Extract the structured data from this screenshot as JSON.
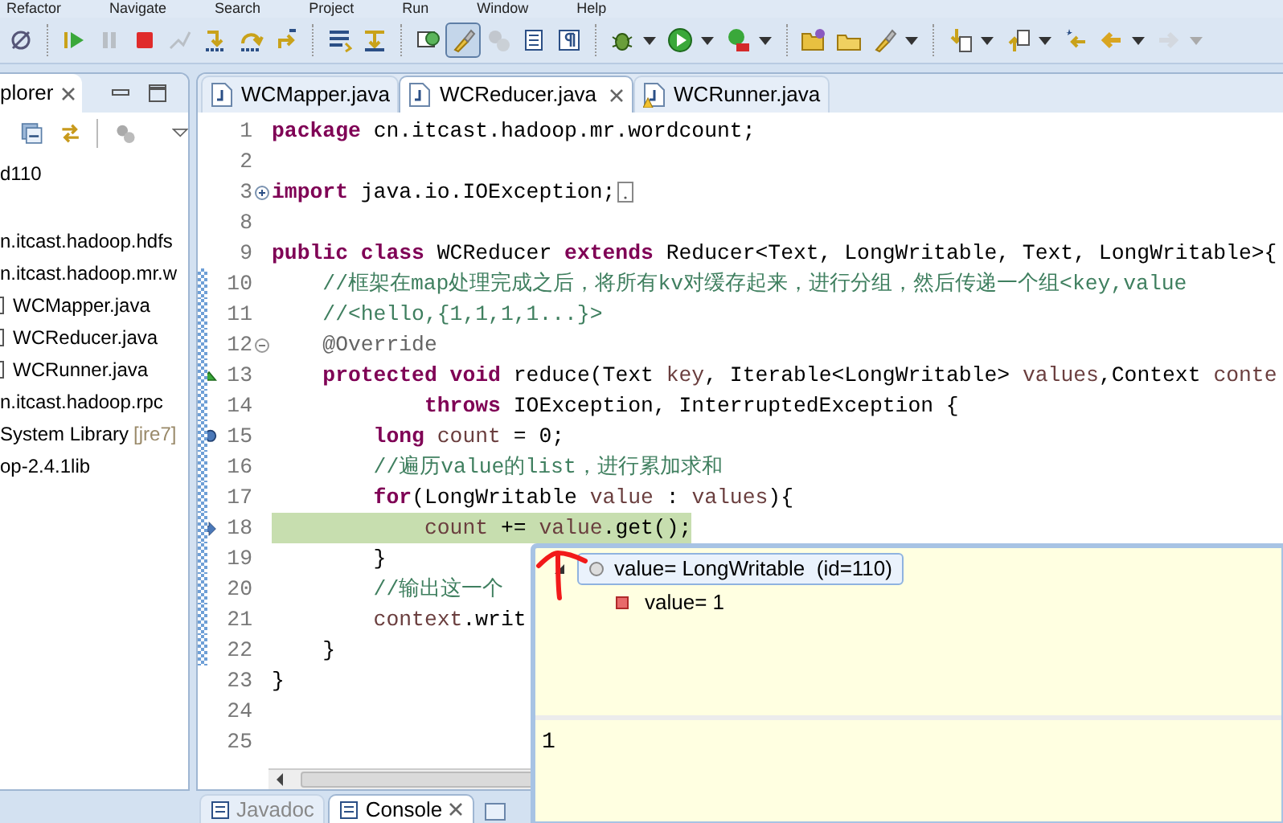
{
  "menu": [
    "Refactor",
    "Navigate",
    "Search",
    "Project",
    "Run",
    "Window",
    "Help"
  ],
  "toolbar": [
    {
      "kind": "link",
      "disabled": false,
      "pressed": false,
      "menu": false
    },
    {
      "kind": "separator"
    },
    {
      "kind": "resume",
      "disabled": false,
      "pressed": false,
      "menu": false
    },
    {
      "kind": "suspend",
      "disabled": true,
      "pressed": false,
      "menu": false
    },
    {
      "kind": "terminate",
      "disabled": false,
      "pressed": false,
      "menu": false
    },
    {
      "kind": "disconnect",
      "disabled": true,
      "pressed": false,
      "menu": false
    },
    {
      "kind": "step-into",
      "disabled": false,
      "pressed": false,
      "menu": false
    },
    {
      "kind": "step-over",
      "disabled": false,
      "pressed": false,
      "menu": false
    },
    {
      "kind": "step-return",
      "disabled": false,
      "pressed": false,
      "menu": false
    },
    {
      "kind": "separator"
    },
    {
      "kind": "lines",
      "disabled": false,
      "pressed": false,
      "menu": false
    },
    {
      "kind": "step-filter",
      "disabled": false,
      "pressed": false,
      "menu": false
    },
    {
      "kind": "separator"
    },
    {
      "kind": "display",
      "disabled": false,
      "pressed": false,
      "menu": false
    },
    {
      "kind": "brush",
      "disabled": false,
      "pressed": true,
      "menu": false
    },
    {
      "kind": "gears",
      "disabled": true,
      "pressed": false,
      "menu": false
    },
    {
      "kind": "document",
      "disabled": false,
      "pressed": false,
      "menu": false
    },
    {
      "kind": "pilcrow",
      "disabled": false,
      "pressed": false,
      "menu": false
    },
    {
      "kind": "separator"
    },
    {
      "kind": "bug",
      "disabled": false,
      "pressed": false,
      "menu": true
    },
    {
      "kind": "run",
      "disabled": false,
      "pressed": false,
      "menu": true
    },
    {
      "kind": "run-toolbox",
      "disabled": false,
      "pressed": false,
      "menu": true
    },
    {
      "kind": "separator"
    },
    {
      "kind": "folder-open",
      "disabled": false,
      "pressed": false,
      "menu": false
    },
    {
      "kind": "folder",
      "disabled": false,
      "pressed": false,
      "menu": false
    },
    {
      "kind": "brush",
      "disabled": false,
      "pressed": false,
      "menu": true
    },
    {
      "kind": "separator"
    },
    {
      "kind": "arrow-down-doc",
      "disabled": false,
      "pressed": false,
      "menu": true
    },
    {
      "kind": "arrow-up-doc",
      "disabled": false,
      "pressed": false,
      "menu": true
    },
    {
      "kind": "star-left",
      "disabled": false,
      "pressed": false,
      "menu": false
    },
    {
      "kind": "arrow-left",
      "disabled": false,
      "pressed": false,
      "menu": true
    },
    {
      "kind": "arrow-right",
      "disabled": true,
      "pressed": false,
      "menu": true
    }
  ],
  "explorer": {
    "tab": "plorer",
    "tree": [
      {
        "label": "d110",
        "children": [
          {
            "label": "n.itcast.hadoop.hdfs"
          },
          {
            "label": "n.itcast.hadoop.mr.w",
            "children": [
              {
                "label": "WCMapper.java"
              },
              {
                "label": "WCReducer.java"
              },
              {
                "label": "WCRunner.java"
              }
            ]
          },
          {
            "label": "n.itcast.hadoop.rpc"
          },
          {
            "label": "System Library",
            "decoration": "[jre7]"
          },
          {
            "label": "op-2.4.1lib"
          }
        ]
      }
    ]
  },
  "editor": {
    "tabs": [
      {
        "label": "WCMapper.java",
        "selected": false,
        "warning": false
      },
      {
        "label": "WCReducer.java",
        "selected": true,
        "warning": false
      },
      {
        "label": "WCRunner.java",
        "selected": false,
        "warning": true
      }
    ],
    "lines": [
      {
        "number": "1",
        "kind": "code",
        "in_range": false,
        "highlighted": false,
        "segments": [
          {
            "kind": "kw",
            "text": "package"
          },
          {
            "kind": "plain",
            "text": " cn.itcast.hadoop.mr.wordcount;"
          }
        ]
      },
      {
        "number": "2",
        "kind": "code",
        "in_range": false,
        "highlighted": false
      },
      {
        "number": "3",
        "kind": "folded",
        "in_range": false,
        "highlighted": false,
        "segments": [
          {
            "kind": "kw",
            "text": "import"
          },
          {
            "kind": "plain",
            "text": " java.io.IOException;"
          }
        ]
      },
      {
        "number": "8",
        "kind": "code",
        "in_range": false,
        "highlighted": false
      },
      {
        "number": "9",
        "kind": "code",
        "in_range": false,
        "highlighted": false,
        "segments": [
          {
            "kind": "kw",
            "text": "public"
          },
          {
            "kind": "kw",
            "text": " class"
          },
          {
            "kind": "plain",
            "text": " WCReducer "
          },
          {
            "kind": "kw",
            "text": "extends"
          },
          {
            "kind": "plain",
            "text": " Reducer<Text, LongWritable, Text, LongWritable>{"
          }
        ]
      },
      {
        "number": "10",
        "kind": "code",
        "in_range": true,
        "highlighted": false,
        "segments": [
          {
            "kind": "comment",
            "text": "    //框架在map处理完成之后，将所有kv对缓存起来，进行分组，然后传递一个组<key,value"
          }
        ]
      },
      {
        "number": "11",
        "kind": "code",
        "in_range": true,
        "highlighted": false,
        "segments": [
          {
            "kind": "comment",
            "text": "    //<hello,{1,1,1,1...}>"
          }
        ]
      },
      {
        "number": "12",
        "kind": "foldable",
        "in_range": true,
        "highlighted": false,
        "segments": [
          {
            "kind": "annotation",
            "text": "    @Override"
          }
        ]
      },
      {
        "number": "13",
        "kind": "override",
        "in_range": true,
        "highlighted": false,
        "segments": [
          {
            "kind": "kw",
            "text": "    protected"
          },
          {
            "kind": "kw",
            "text": " void"
          },
          {
            "kind": "plain",
            "text": " reduce(Text "
          },
          {
            "kind": "var",
            "text": "key"
          },
          {
            "kind": "plain",
            "text": ", Iterable<LongWritable> "
          },
          {
            "kind": "var",
            "text": "values"
          },
          {
            "kind": "plain",
            "text": ",Context "
          },
          {
            "kind": "var",
            "text": "conte"
          }
        ]
      },
      {
        "number": "14",
        "kind": "code",
        "in_range": true,
        "highlighted": false,
        "segments": [
          {
            "kind": "kw",
            "text": "            throws"
          },
          {
            "kind": "plain",
            "text": " IOException, InterruptedException {"
          }
        ]
      },
      {
        "number": "15",
        "kind": "breakpoint",
        "in_range": true,
        "highlighted": false,
        "segments": [
          {
            "kind": "kw",
            "text": "        long"
          },
          {
            "kind": "var",
            "text": " count"
          },
          {
            "kind": "plain",
            "text": " = 0;"
          }
        ]
      },
      {
        "number": "16",
        "kind": "code",
        "in_range": true,
        "highlighted": false,
        "segments": [
          {
            "kind": "comment",
            "text": "        //遍历value的list，进行累加求和"
          }
        ]
      },
      {
        "number": "17",
        "kind": "code",
        "in_range": true,
        "highlighted": false,
        "segments": [
          {
            "kind": "kw",
            "text": "        for"
          },
          {
            "kind": "plain",
            "text": "(LongWritable "
          },
          {
            "kind": "var",
            "text": "value"
          },
          {
            "kind": "plain",
            "text": " : "
          },
          {
            "kind": "var",
            "text": "values"
          },
          {
            "kind": "plain",
            "text": "){"
          }
        ]
      },
      {
        "number": "18",
        "kind": "current",
        "in_range": true,
        "highlighted": true,
        "segments": [
          {
            "kind": "var",
            "text": "            count"
          },
          {
            "kind": "plain",
            "text": " += "
          },
          {
            "kind": "var",
            "text": "value"
          },
          {
            "kind": "plain",
            "text": ".get();"
          }
        ]
      },
      {
        "number": "19",
        "kind": "code",
        "in_range": true,
        "highlighted": false,
        "segments": [
          {
            "kind": "plain",
            "text": "        }"
          }
        ]
      },
      {
        "number": "20",
        "kind": "code",
        "in_range": true,
        "highlighted": false,
        "segments": [
          {
            "kind": "comment",
            "text": "        //输出这一个"
          }
        ]
      },
      {
        "number": "21",
        "kind": "code",
        "in_range": true,
        "highlighted": false,
        "segments": [
          {
            "kind": "var",
            "text": "        context"
          },
          {
            "kind": "plain",
            "text": ".writ"
          }
        ]
      },
      {
        "number": "22",
        "kind": "code",
        "in_range": true,
        "highlighted": false,
        "segments": [
          {
            "kind": "plain",
            "text": "    }"
          }
        ]
      },
      {
        "number": "23",
        "kind": "code",
        "in_range": false,
        "highlighted": false,
        "segments": [
          {
            "kind": "plain",
            "text": "}"
          }
        ]
      },
      {
        "number": "24",
        "kind": "code",
        "in_range": false,
        "highlighted": false
      },
      {
        "number": "25",
        "kind": "code",
        "in_range": false,
        "highlighted": false
      }
    ]
  },
  "hover": {
    "tree": [
      {
        "label": "value= LongWritable  (id=110)",
        "selected": true,
        "expanded": true,
        "children": [
          {
            "label": "value= 1",
            "selected": false
          }
        ]
      }
    ],
    "detail": "1"
  },
  "bottom_tabs": [
    {
      "label": "Javadoc",
      "selected": false
    },
    {
      "label": "Console",
      "selected": true
    }
  ]
}
